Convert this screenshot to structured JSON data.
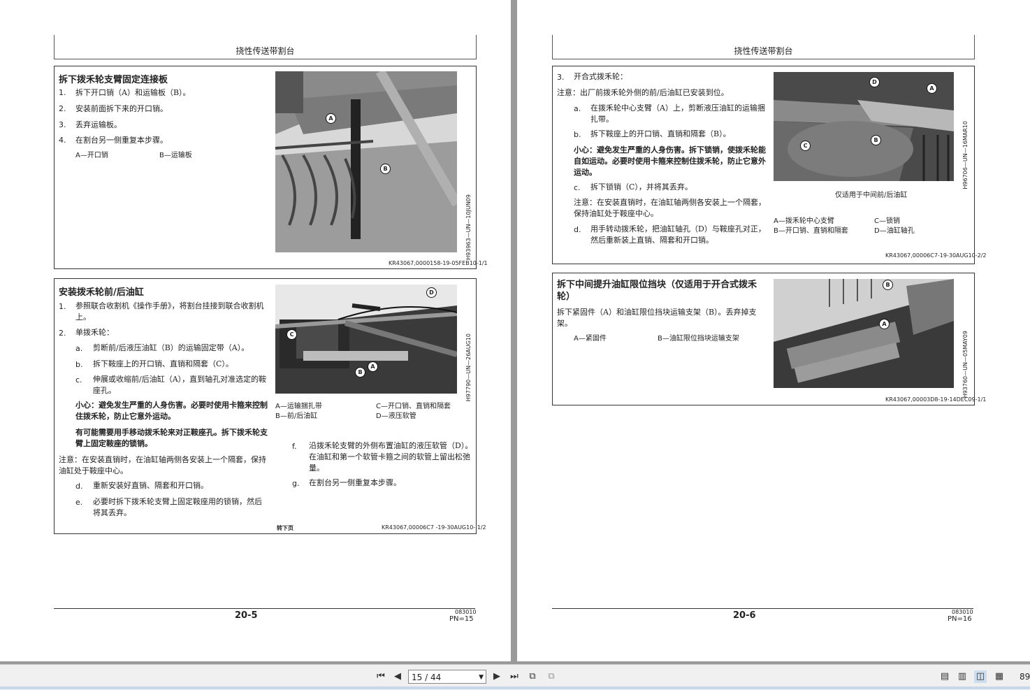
{
  "page_indicator": "15 / 44",
  "zoom_partial": "89",
  "left_page": {
    "header": "挠性传送带割台",
    "sec1": {
      "title": "拆下拨禾轮支臂固定连接板",
      "steps": [
        {
          "n": "1.",
          "text": "拆下开口销（A）和运输板（B）。"
        },
        {
          "n": "2.",
          "text": "安装前面拆下来的开口销。"
        },
        {
          "n": "3.",
          "text": "丢弃运输板。"
        },
        {
          "n": "4.",
          "text": "在割台另一侧重复本步骤。"
        }
      ],
      "legend_a": "A—开口销",
      "legend_b": "B—运输板",
      "fig_code": "H93963—UN—10JUN09",
      "ref": "KR43067,0000158-19-05FEB10-1/1"
    },
    "sec2": {
      "title": "安装拨禾轮前/后油缸",
      "s1_n": "1.",
      "s1_text": "参照联合收割机《操作手册》，将割台挂接到联合收割机上。",
      "s2_n": "2.",
      "s2_text": "单拨禾轮：",
      "a_n": "a.",
      "a_text": "剪断前/后液压油缸（B）的运输固定带（A）。",
      "b_n": "b.",
      "b_text": "拆下鞍座上的开口销、直销和隔套（C）。",
      "c_n": "c.",
      "c_text": "伸展或收缩前/后油缸（A），直到轴孔对准选定的鞍座孔。",
      "caution": "小心：避免发生严重的人身伤害。必要时使用卡箍来控制住拨禾轮，防止它意外运动。",
      "may_need": "有可能需要用手移动拨禾轮来对正鞍座孔。拆下拨禾轮支臂上固定鞍座的锁销。",
      "note": "注意：在安装直销时，在油缸轴两侧各安装上一个隔套，保持油缸处于鞍座中心。",
      "d_n": "d.",
      "d_text": "重新安装好直销、隔套和开口销。",
      "e_n": "e.",
      "e_text": "必要时拆下拨禾轮支臂上固定鞍座用的锁销，然后将其丢弃。",
      "f_n": "f.",
      "f_text": "沿拨禾轮支臂的外侧布置油缸的液压软管（D）。在油缸和第一个软管卡箍之间的软管上留出松弛量。",
      "g_n": "g.",
      "g_text": "在割台另一侧重复本步骤。",
      "legend": [
        "A—运输捆扎带",
        "C—开口销、直销和隔套",
        "B—前/后油缸",
        "D—液压软管"
      ],
      "fig_code": "H97790—UN—26AUG10",
      "continued": "转下页",
      "ref": "KR43067,00006C7 -19-30AUG10- 1/2"
    },
    "page_number": "20-5",
    "doc_code": "083010",
    "pn": "PN=15"
  },
  "right_page": {
    "header": "挠性传送带割台",
    "sec1": {
      "s3_n": "3.",
      "s3_text": "开合式拨禾轮：",
      "note": "注意：出厂前拨禾轮外侧的前/后油缸已安装到位。",
      "a_n": "a.",
      "a_text": "在拨禾轮中心支臂（A）上，剪断液压油缸的运输捆扎带。",
      "b_n": "b.",
      "b_text": "拆下鞍座上的开口销、直销和隔套（B）。",
      "caution": "小心：避免发生严重的人身伤害。拆下锁销，使拨禾轮能自如运动。必要时使用卡箍来控制住拨禾轮，防止它意外运动。",
      "c_n": "c.",
      "c_text": "拆下锁销（C），并将其丢弃。",
      "note2": "注意：在安装直销时，在油缸轴两侧各安装上一个隔套，保持油缸处于鞍座中心。",
      "d_n": "d.",
      "d_text": "用手转动拨禾轮，把油缸轴孔（D）与鞍座孔对正，然后重新装上直销、隔套和开口销。",
      "fig_caption": "仅适用于中间前/后油缸",
      "fig_code": "H96706—UN—16MAR10",
      "legend": [
        "A—拨禾轮中心支臂",
        "C—锁销",
        "B—开口销、直销和隔套",
        "D—油缸轴孔"
      ],
      "ref": "KR43067,00006C7-19-30AUG10-2/2"
    },
    "sec2": {
      "title": "拆下中间提升油缸限位挡块（仅适用于开合式拨禾轮）",
      "text": "拆下紧固件（A）和油缸限位挡块运输支架（B）。丢弃掉支架。",
      "legend_a": "A—紧固件",
      "legend_b": "B—油缸限位挡块运输支架",
      "fig_code": "H93760—UN—05MAY09",
      "ref": "KR43067,00003D8-19-14DEC09-1/1"
    },
    "page_number": "20-6",
    "doc_code": "083010",
    "pn": "PN=16"
  },
  "callouts": {
    "a": "A",
    "b": "B",
    "c": "C",
    "d": "D"
  },
  "toolbar": {
    "first_icon": "first-page-icon",
    "prev_icon": "prev-page-icon",
    "next_icon": "next-page-icon",
    "last_icon": "last-page-icon"
  }
}
